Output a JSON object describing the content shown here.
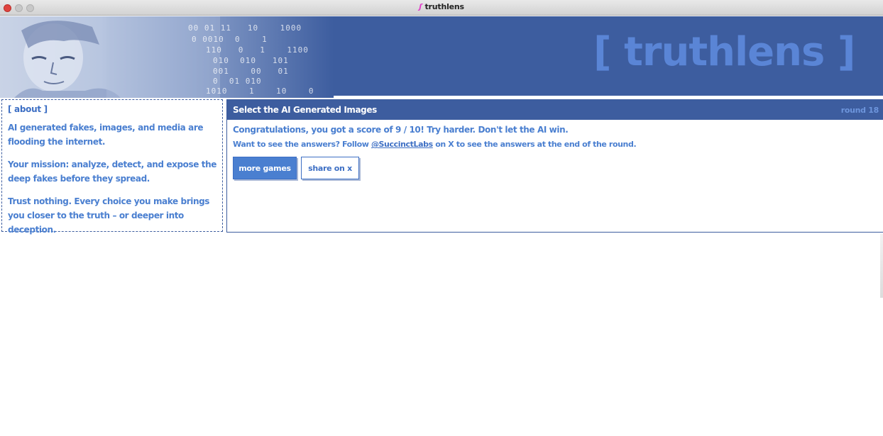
{
  "window": {
    "title": "truthlens",
    "icon": "scribble-icon"
  },
  "banner": {
    "logo": "[ truthlens ]",
    "binary_lines": [
      "00 01 11   10    1000",
      "0 0010  0    1",
      "110   0   1    1100",
      "010  010   101",
      "001    00   01",
      "0  01 010",
      "1010    1    10    0"
    ]
  },
  "about": {
    "title": "[ about ]",
    "paragraphs": [
      "AI generated fakes, images, and media are flooding the internet.",
      "Your mission: analyze, detect, and expose the deep fakes before they spread.",
      "Trust nothing. Every choice you make brings you closer to the truth – or deeper into deception."
    ]
  },
  "game": {
    "title": "Select the AI Generated Images",
    "round": "round 18",
    "score_text": "Congratulations, you got a score of 9 / 10! Try harder. Don't let the AI win.",
    "answers_prefix": "Want to see the answers? Follow ",
    "answers_link": "@SuccinctLabs",
    "answers_suffix": " on X to see the answers at the end of the round.",
    "more_games_label": "more games",
    "share_label": "share on x"
  },
  "colors": {
    "banner_bg": "#3d5d9f",
    "accent": "#4a7fd0",
    "logo": "#5a85d6"
  }
}
